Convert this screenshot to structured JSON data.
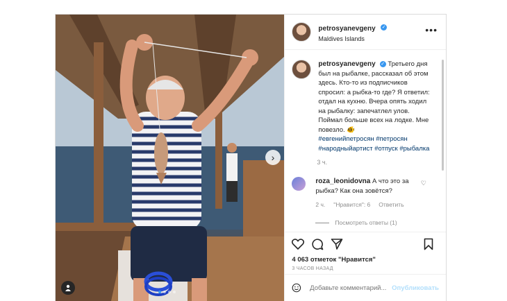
{
  "post": {
    "username": "petrosyanevgeny",
    "location": "Maldives Islands",
    "caption": "Третьего дня был на рыбалке, рассказал об этом здесь. Кто-то из подписчиков спросил: а рыбка-то где? Я ответил: отдал на кухню. Вчера опять ходил на рыбалку: запечатлел улов. Поймал больше всех на лодке. Мне повезло. 🐠",
    "hashtags": [
      "#евгенийпетросян",
      "#петросян",
      "#народныйартист",
      "#отпуск",
      "#рыбалка"
    ],
    "caption_time": "3 ч.",
    "likes": "4 063 отметок \"Нравится\"",
    "posted_ago": "3 ЧАСОВ НАЗАД"
  },
  "comment": {
    "username": "roza_leonidovna",
    "text": "А что это за рыбка? Как она зовётся?",
    "time": "2 ч.",
    "likes": "\"Нравится\": 6",
    "reply": "Ответить",
    "view_replies": "Посмотреть ответы (1)"
  },
  "add_comment": {
    "placeholder": "Добавьте комментарий...",
    "publish": "Опубликовать"
  },
  "icons": {
    "verified": "verified-badge-icon",
    "more": "more-options-icon",
    "like": "heart-icon",
    "comment": "comment-icon",
    "share": "share-icon",
    "save": "bookmark-icon",
    "emoji": "emoji-icon",
    "tag": "user-tag-icon",
    "next": "chevron-right-icon"
  },
  "colors": {
    "verified": "#3897f0",
    "link": "#00376b",
    "publish_disabled": "#b2dffc"
  }
}
